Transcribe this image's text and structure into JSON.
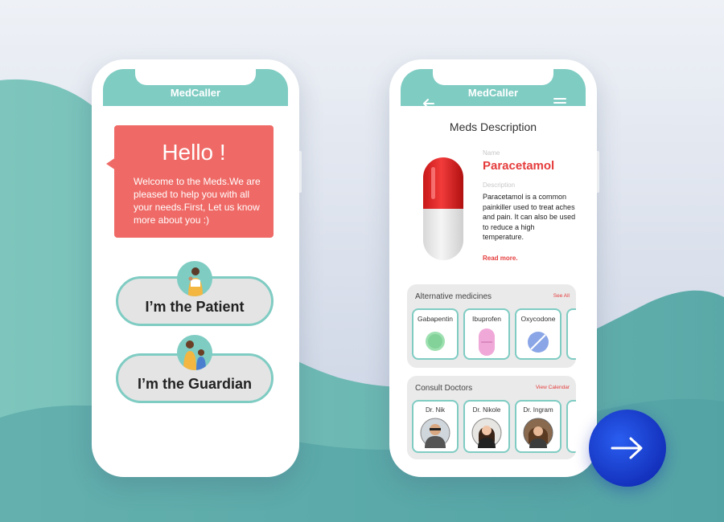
{
  "colors": {
    "teal": "#7fccc3",
    "coral": "#ef6a66",
    "red_accent": "#e53c3c",
    "blue_button": "#1440d0"
  },
  "left_phone": {
    "app_title": "MedCaller",
    "greeting": "Hello !",
    "welcome_text": "Welcome to the Meds.We are pleased to help you with all your needs.First, Let us know more about you :)",
    "patient_button": "I’m the Patient",
    "guardian_button": "I’m the Guardian"
  },
  "right_phone": {
    "app_title": "MedCaller",
    "back_icon": "arrow-left-icon",
    "menu_icon": "hamburger-menu-icon",
    "section_title": "Meds Description",
    "name_label": "Name",
    "med_name": "Paracetamol",
    "description_label": "Description",
    "description": "Paracetamol is a common painkiller used to treat aches and pain. It can also be used to reduce a high temperature.",
    "read_more": "Read more.",
    "alternatives": {
      "title": "Alternative medicines",
      "see_all": "See All",
      "items": [
        {
          "name": "Gabapentin",
          "icon": "green-round-pill-icon"
        },
        {
          "name": "Ibuprofen",
          "icon": "pink-capsule-icon"
        },
        {
          "name": "Oxycodone",
          "icon": "blue-split-pill-icon"
        }
      ]
    },
    "doctors": {
      "title": "Consult Doctors",
      "view_calendar": "View Calendar",
      "items": [
        {
          "name": "Dr. Nik"
        },
        {
          "name": "Dr. Nikole"
        },
        {
          "name": "Dr. Ingram"
        }
      ]
    }
  },
  "next_button_icon": "arrow-right-icon"
}
